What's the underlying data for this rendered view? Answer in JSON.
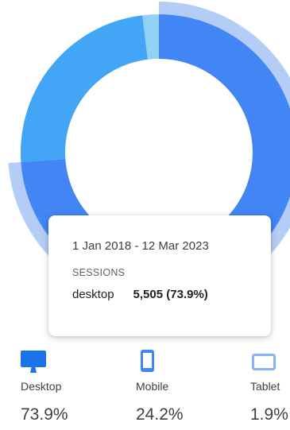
{
  "chart_data": {
    "type": "pie",
    "donut": true,
    "categories": [
      "Desktop",
      "Mobile",
      "Tablet"
    ],
    "values": [
      73.9,
      24.2,
      1.9
    ],
    "highlighted": "Desktop"
  },
  "tooltip": {
    "date_range": "1 Jan 2018 - 12 Mar 2023",
    "metric": "SESSIONS",
    "category": "desktop",
    "value": "5,505 (73.9%)"
  },
  "legend": [
    {
      "label": "Desktop",
      "pct": "73.9%",
      "icon": "desktop-icon",
      "color": "#4285f4"
    },
    {
      "label": "Mobile",
      "pct": "24.2%",
      "icon": "mobile-icon",
      "color": "#42a5f5"
    },
    {
      "label": "Tablet",
      "pct": "1.9%",
      "icon": "tablet-icon",
      "color": "#91d2f4"
    }
  ],
  "colors": {
    "desktop": "#4285f4",
    "mobile": "#42a5f5",
    "tablet": "#91d2f4",
    "highlight_ring": "#b4cdf7"
  }
}
